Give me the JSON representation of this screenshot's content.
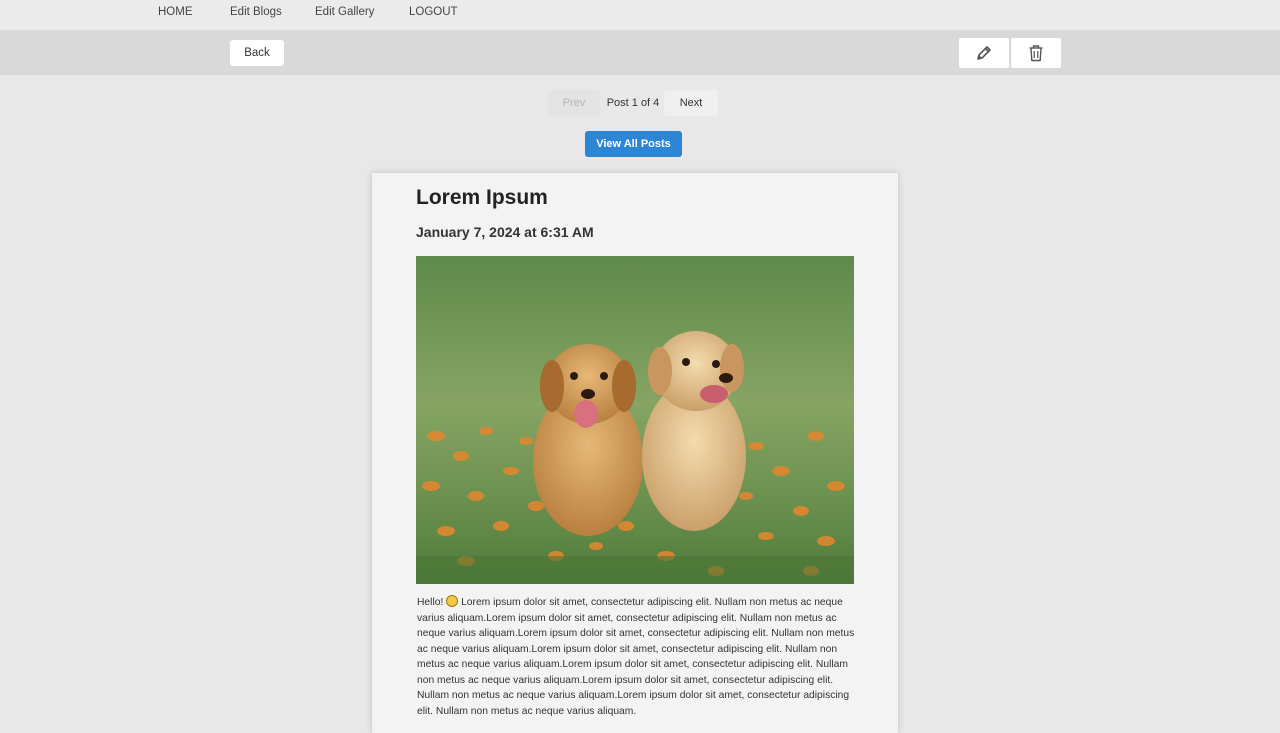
{
  "nav": {
    "items": [
      {
        "label": "HOME"
      },
      {
        "label": "Edit Blogs"
      },
      {
        "label": "Edit Gallery"
      },
      {
        "label": "LOGOUT"
      }
    ]
  },
  "toolbar": {
    "back_label": "Back",
    "edit_icon": "pencil-icon",
    "delete_icon": "trash-icon"
  },
  "pager": {
    "prev_label": "Prev",
    "status": "Post 1 of 4",
    "next_label": "Next"
  },
  "view_all_label": "View All Posts",
  "post": {
    "title": "Lorem Ipsum",
    "date": "January 7, 2024 at 6:31 AM",
    "image_icon": "two-puppies-photo",
    "body_greeting": "Hello!",
    "body_emoji": "grinning-face-emoji",
    "body_text": "Lorem ipsum dolor sit amet, consectetur adipiscing elit. Nullam non metus ac neque varius aliquam.Lorem ipsum dolor sit amet, consectetur adipiscing elit. Nullam non metus ac neque varius aliquam.Lorem ipsum dolor sit amet, consectetur adipiscing elit. Nullam non metus ac neque varius aliquam.Lorem ipsum dolor sit amet, consectetur adipiscing elit. Nullam non metus ac neque varius aliquam.Lorem ipsum dolor sit amet, consectetur adipiscing elit. Nullam non metus ac neque varius aliquam.Lorem ipsum dolor sit amet, consectetur adipiscing elit. Nullam non metus ac neque varius aliquam.Lorem ipsum dolor sit amet, consectetur adipiscing elit. Nullam non metus ac neque varius aliquam."
  },
  "colors": {
    "accent": "#2d86d5",
    "page_bg": "#e8e8e8",
    "toolbar_bg": "#d9d9d9"
  }
}
